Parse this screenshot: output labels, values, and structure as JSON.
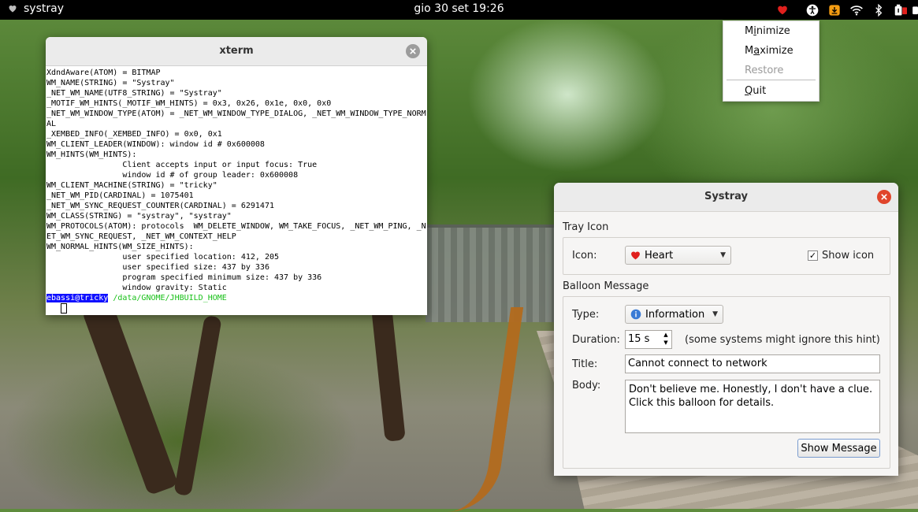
{
  "topbar": {
    "app_name": "systray",
    "clock": "gio 30 set  19:26",
    "tray_icons": [
      "heart-icon",
      "accessibility-icon",
      "software-update-icon",
      "wifi-icon",
      "bluetooth-icon",
      "battery-icon"
    ]
  },
  "context_menu": {
    "items": [
      {
        "label": "Minimize",
        "mnemonic": "i"
      },
      {
        "label": "Maximize",
        "mnemonic": "a"
      },
      {
        "label": "Restore",
        "mnemonic": "",
        "disabled": true
      },
      {
        "label": "Quit",
        "mnemonic": "Q"
      }
    ]
  },
  "xterm": {
    "title": "xterm",
    "lines": [
      "XdndAware(ATOM) = BITMAP",
      "WM_NAME(STRING) = \"Systray\"",
      "_NET_WM_NAME(UTF8_STRING) = \"Systray\"",
      "_MOTIF_WM_HINTS(_MOTIF_WM_HINTS) = 0x3, 0x26, 0x1e, 0x0, 0x0",
      "_NET_WM_WINDOW_TYPE(ATOM) = _NET_WM_WINDOW_TYPE_DIALOG, _NET_WM_WINDOW_TYPE_NORM",
      "AL",
      "_XEMBED_INFO(_XEMBED_INFO) = 0x0, 0x1",
      "WM_CLIENT_LEADER(WINDOW): window id # 0x600008",
      "WM_HINTS(WM_HINTS):",
      "                Client accepts input or input focus: True",
      "                window id # of group leader: 0x600008",
      "WM_CLIENT_MACHINE(STRING) = \"tricky\"",
      "_NET_WM_PID(CARDINAL) = 1075401",
      "_NET_WM_SYNC_REQUEST_COUNTER(CARDINAL) = 6291471",
      "WM_CLASS(STRING) = \"systray\", \"systray\"",
      "WM_PROTOCOLS(ATOM): protocols  WM_DELETE_WINDOW, WM_TAKE_FOCUS, _NET_WM_PING, _N",
      "ET_WM_SYNC_REQUEST, _NET_WM_CONTEXT_HELP",
      "WM_NORMAL_HINTS(WM_SIZE_HINTS):",
      "                user specified location: 412, 205",
      "                user specified size: 437 by 336",
      "                program specified minimum size: 437 by 336",
      "                window gravity: Static"
    ],
    "prompt_host": "ebassi@tricky",
    "prompt_path": "/data/GNOME/JHBUILD_HOME"
  },
  "dialog": {
    "title": "Systray",
    "tray_icon": {
      "section_label": "Tray Icon",
      "icon_label": "Icon:",
      "icon_value": "Heart",
      "show_icon_label": "Show icon",
      "show_icon_checked": "✓"
    },
    "balloon": {
      "section_label": "Balloon Message",
      "type_label": "Type:",
      "type_value": "Information",
      "duration_label": "Duration:",
      "duration_value": "15 s",
      "duration_hint": "(some systems might ignore this hint)",
      "title_label": "Title:",
      "title_value": "Cannot connect to network",
      "body_label": "Body:",
      "body_value": "Don't believe me. Honestly, I don't have a clue.\nClick this balloon for details.",
      "show_button": "Show Message"
    }
  },
  "colors": {
    "heart": "#e0201d",
    "close_active": "#e0452b",
    "info": "#3a7bd5",
    "prompt_host_bg": "#1010ff",
    "prompt_path": "#18c018"
  }
}
